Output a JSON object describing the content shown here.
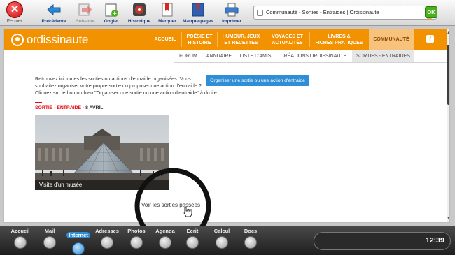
{
  "toolbar": {
    "close_label": "Fermer",
    "items": [
      {
        "label": "Précédente",
        "icon": "back-arrow-icon",
        "enabled": true
      },
      {
        "label": "Suivante",
        "icon": "forward-arrow-icon",
        "enabled": false
      },
      {
        "label": "Onglet",
        "icon": "new-tab-icon",
        "enabled": true
      },
      {
        "label": "Historique",
        "icon": "history-icon",
        "enabled": true
      },
      {
        "label": "Marquer",
        "icon": "bookmark-icon",
        "enabled": true
      },
      {
        "label": "Marque-pages",
        "icon": "bookmarks-list-icon",
        "enabled": true
      },
      {
        "label": "Imprimer",
        "icon": "printer-icon",
        "enabled": true
      }
    ],
    "url": "Communauté - Sorties - Entraides | Ordissinaute",
    "go_label": "OK"
  },
  "site": {
    "logo": "ordissinaute",
    "nav": [
      {
        "line1": "ACCUEIL",
        "line2": ""
      },
      {
        "line1": "POÉSIE ET",
        "line2": "HISTOIRE"
      },
      {
        "line1": "HUMOUR, JEUX",
        "line2": "ET RECETTES"
      },
      {
        "line1": "VOYAGES ET",
        "line2": "ACTUALITÉS"
      },
      {
        "line1": "LIVRES &",
        "line2": "FICHES PRATIQUES"
      },
      {
        "line1": "COMMUNAUTÉ",
        "line2": ""
      }
    ],
    "facebook": "f",
    "subnav": [
      "FORUM",
      "ANNUAIRE",
      "LISTE D'AMIS",
      "CRÉATIONS ORDISSINAUTE",
      "SORTIES - ENTRAIDES"
    ]
  },
  "content": {
    "intro_lines": [
      "Retrouvez ici toutes les sorties ou actions d'entraide organisées. Vous",
      "souhaitez organiser votre propre sortie ou proposer une action d'entraide ?",
      "Cliquez sur le bouton bleu \"Organiser une sortie ou une action d'entraide\" à droite."
    ],
    "organize_button": "Organiser une sortie ou une action d'entraide",
    "event_category": "SORTIE - ENTRAIDE",
    "event_date": " - 8 AVRIL",
    "event_caption": "Visite d'un musée",
    "past_events_button": "Voir les sorties passées"
  },
  "dock": {
    "items": [
      {
        "label": "Accueil",
        "icon": "home-icon"
      },
      {
        "label": "Mail",
        "icon": "mail-icon"
      },
      {
        "label": "Internet",
        "icon": "globe-icon",
        "active": true
      },
      {
        "label": "Adresses",
        "icon": "contacts-icon"
      },
      {
        "label": "Photos",
        "icon": "camera-icon"
      },
      {
        "label": "Agenda",
        "icon": "calendar-icon"
      },
      {
        "label": "Ecrit",
        "icon": "pen-icon"
      },
      {
        "label": "Calcul",
        "icon": "calculator-icon"
      },
      {
        "label": "Docs",
        "icon": "documents-icon"
      }
    ],
    "clock": "12:39"
  }
}
